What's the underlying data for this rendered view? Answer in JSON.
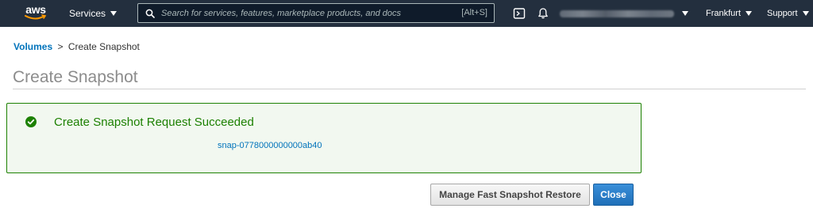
{
  "header": {
    "logo_text": "aws",
    "services_label": "Services",
    "search_placeholder": "Search for services, features, marketplace products, and docs",
    "search_shortcut": "[Alt+S]",
    "region_label": "Frankfurt",
    "support_label": "Support",
    "icons": [
      "cloudshell-icon",
      "bell-icon",
      "search-icon",
      "caret-down-icon"
    ]
  },
  "breadcrumb": {
    "parent": "Volumes",
    "separator": ">",
    "current": "Create Snapshot"
  },
  "page": {
    "title": "Create Snapshot"
  },
  "success": {
    "title": "Create Snapshot Request Succeeded",
    "snapshot_id": "snap-0778000000000ab40"
  },
  "actions": {
    "secondary_label": "Manage Fast Snapshot Restore",
    "primary_label": "Close"
  },
  "colors": {
    "nav_bg": "#232f3e",
    "logo_smile": "#ff9900",
    "success_green": "#1d8102",
    "link_blue": "#0073bb",
    "primary_button": "#2474c4"
  }
}
